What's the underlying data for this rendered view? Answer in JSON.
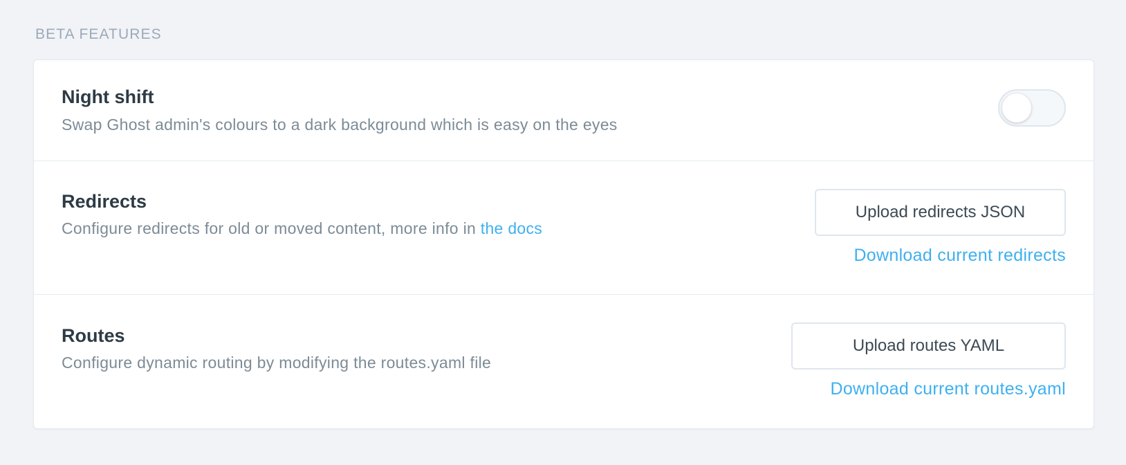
{
  "section": {
    "title": "Beta features"
  },
  "night_shift": {
    "title": "Night shift",
    "description": "Swap Ghost admin's colours to a dark background which is easy on the eyes",
    "enabled": false
  },
  "redirects": {
    "title": "Redirects",
    "description_prefix": "Configure redirects for old or moved content, more info in ",
    "docs_link": "the docs",
    "upload_button": "Upload redirects JSON",
    "download_link": "Download current redirects"
  },
  "routes": {
    "title": "Routes",
    "description": "Configure dynamic routing by modifying the routes.yaml file",
    "upload_button": "Upload routes YAML",
    "download_link": "Download current routes.yaml"
  },
  "colors": {
    "accent": "#3eb0ef",
    "background": "#f1f3f7",
    "panel": "#ffffff"
  }
}
